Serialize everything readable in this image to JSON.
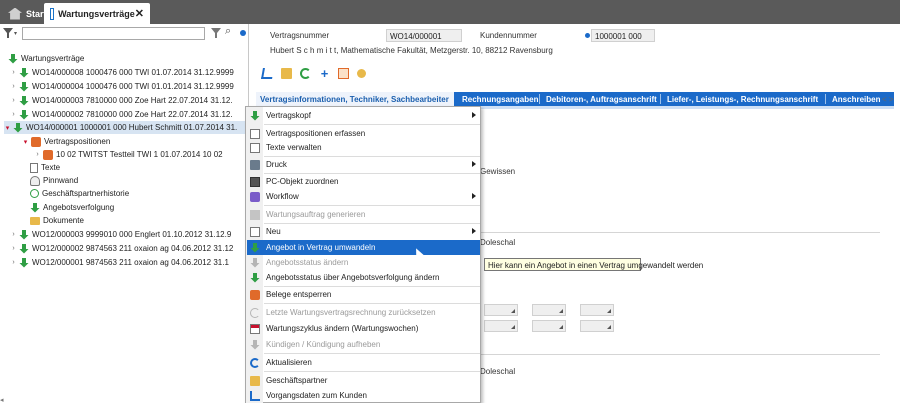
{
  "tabs": {
    "start": "Start",
    "active": "Wartungsverträge",
    "close": "✕"
  },
  "filter": {
    "value": "",
    "placeholder": ""
  },
  "tree": {
    "root": "Wartungsverträge",
    "rows": [
      {
        "text": "WO14/000008  1000476  000  TWI  01.07.2014  31.12.9999",
        "expander": "›",
        "selected": false
      },
      {
        "text": "WO14/000004  1000476  000  TWI  01.01.2014  31.12.9999",
        "expander": "›",
        "selected": false
      },
      {
        "text": "WO14/000003  7810000  000  Zoe Hart  22.07.2014  31.12.",
        "expander": "›",
        "selected": false
      },
      {
        "text": "WO14/000002  7810000  000  Zoe Hart  22.07.2014  31.12.",
        "expander": "›",
        "selected": false
      },
      {
        "text": "WO14/000001  1000001  000  Hubert Schmitt  01.07.2014  31.",
        "expander": "▾",
        "selected": true
      }
    ],
    "positions_label": "Vertragspositionen",
    "position_row": "10  02  TWITST Testteil TWI  1  01.07.2014    10  02",
    "children": [
      "Texte",
      "Pinnwand",
      "Geschäftspartnerhistorie",
      "Angebotsverfolgung",
      "Dokumente"
    ],
    "more_rows": [
      "WO12/000003  9999010  000  Englert  01.10.2012  31.12.9",
      "WO12/000002  9874563  211  oxaion ag  04.06.2012  31.12",
      "WO12/000001  9874563  211  oxaion ag  04.06.2012  31.1"
    ]
  },
  "header": {
    "contract_number_label": "Vertragsnummer",
    "contract_number": "WO14/000001",
    "customer_number_label": "Kundennummer",
    "customer_number": "1000001 000",
    "address": "Hubert S c h m i t t, Mathematische Fakultät, Metzgerstr. 10, 88212 Ravensburg"
  },
  "toolbar_icons": [
    "cart-icon",
    "mail-icon",
    "refresh-icon",
    "plus-icon",
    "archive-icon",
    "people-icon"
  ],
  "detail_tabs": [
    "Vertragsinformationen, Techniker, Sachbearbeiter",
    "Rechnungsangaben",
    "Debitoren-, Auftragsanschrift",
    "Liefer-, Leistungs-, Rechnungsanschrift",
    "Anschreiben"
  ],
  "tab_scroll": "< >",
  "background_text": {
    "gewissen": "Gewissen",
    "doleschal1": "Doleschal",
    "doleschal2": "Doleschal"
  },
  "context_menu": [
    {
      "label": "Vertragskopf",
      "icon": "contract-icon",
      "submenu": true,
      "disabled": false
    },
    {
      "label": "Vertragspositionen erfassen",
      "icon": "page-icon",
      "submenu": false,
      "disabled": false
    },
    {
      "label": "Texte verwalten",
      "icon": "page-icon",
      "submenu": false,
      "disabled": false
    },
    {
      "label": "Druck",
      "icon": "print-icon",
      "submenu": true,
      "disabled": false
    },
    {
      "label": "PC-Objekt zuordnen",
      "icon": "pc-icon",
      "submenu": false,
      "disabled": false
    },
    {
      "label": "Workflow",
      "icon": "workflow-icon",
      "submenu": true,
      "disabled": false
    },
    {
      "label": "Wartungsauftrag generieren",
      "icon": "generate-icon",
      "submenu": false,
      "disabled": true
    },
    {
      "label": "Neu",
      "icon": "new-icon",
      "submenu": true,
      "disabled": false
    },
    {
      "label": "Angebot in Vertrag umwandeln",
      "icon": "convert-icon",
      "submenu": false,
      "disabled": false,
      "highlighted": true
    },
    {
      "label": "Angebotsstatus ändern",
      "icon": "status-icon",
      "submenu": false,
      "disabled": true
    },
    {
      "label": "Angebotsstatus über Angebotsverfolgung ändern",
      "icon": "status-icon",
      "submenu": false,
      "disabled": false
    },
    {
      "label": "Belege entsperren",
      "icon": "unlock-icon",
      "submenu": false,
      "disabled": false
    },
    {
      "label": "Letzte Wartungsvertragsrechnung zurücksetzen",
      "icon": "reset-icon",
      "submenu": false,
      "disabled": true
    },
    {
      "label": "Wartungszyklus ändern (Wartungswochen)",
      "icon": "calendar-icon",
      "submenu": false,
      "disabled": false
    },
    {
      "label": "Kündigen / Kündigung aufheben",
      "icon": "cancel-icon",
      "submenu": false,
      "disabled": true
    },
    {
      "label": "Aktualisieren",
      "icon": "refresh-icon",
      "submenu": false,
      "disabled": false
    },
    {
      "label": "Geschäftspartner",
      "icon": "partner-icon",
      "submenu": false,
      "disabled": false
    },
    {
      "label": "Vorgangsdaten zum Kunden",
      "icon": "cart-icon",
      "submenu": false,
      "disabled": false
    }
  ],
  "tooltip": "Hier kann ein Angebot in einen Vertrag umgewandelt werden"
}
